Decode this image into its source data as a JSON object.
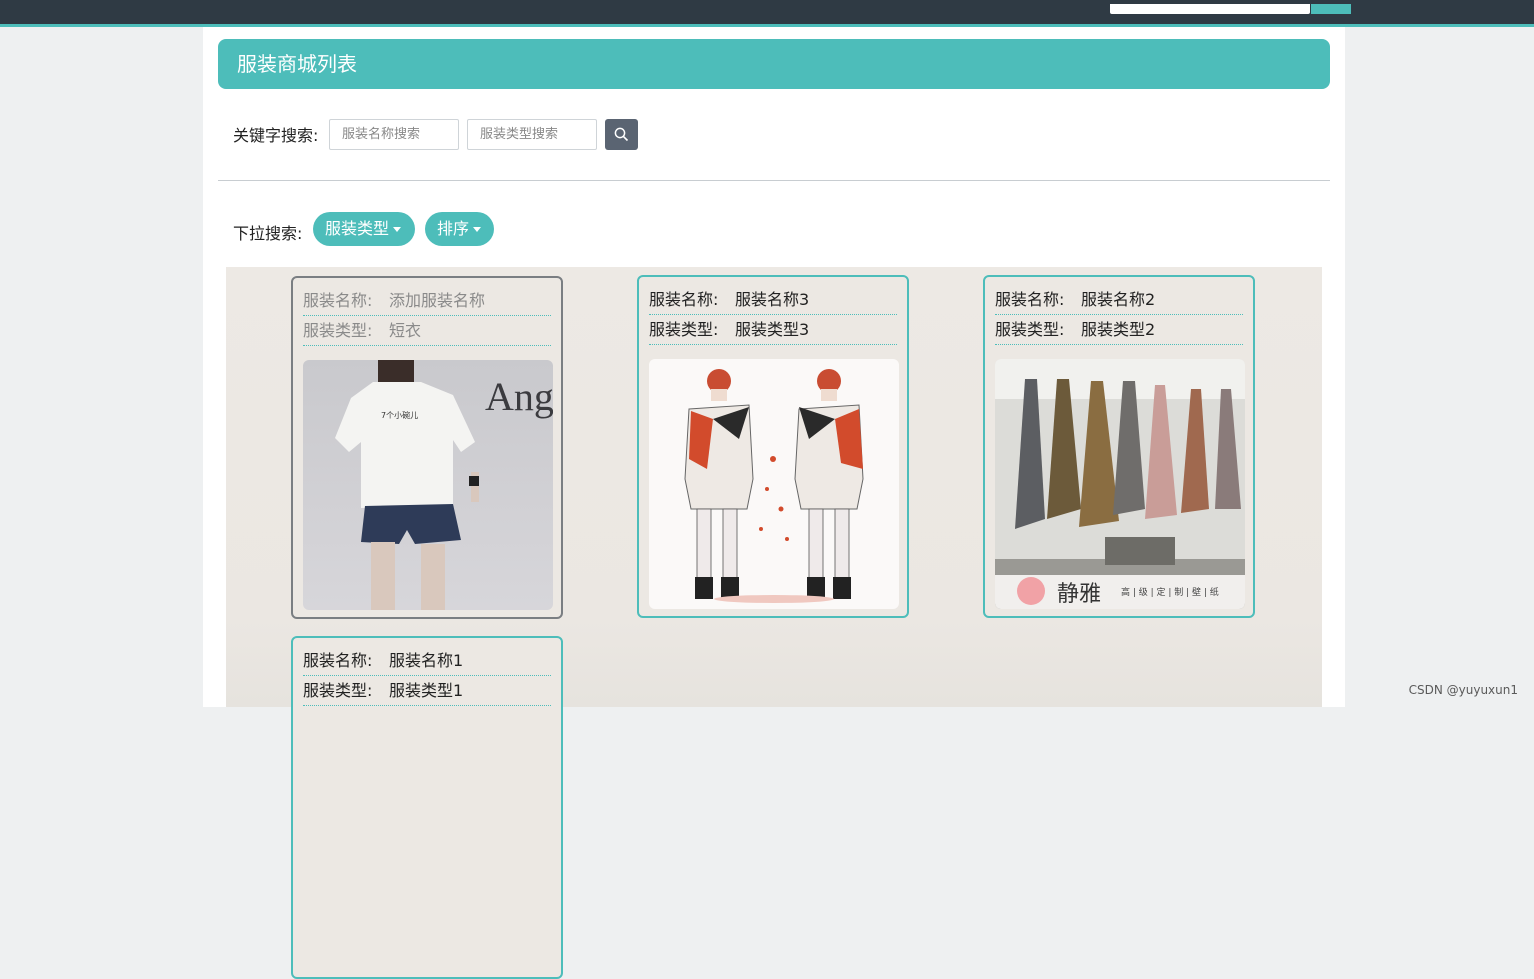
{
  "colors": {
    "accent": "#4dbdba",
    "topbar": "#2f3a44",
    "search_button": "#5a6472"
  },
  "page": {
    "title": "服装商城列表"
  },
  "keyword_search": {
    "label": "关键字搜索:",
    "name_placeholder": "服装名称搜索",
    "type_placeholder": "服装类型搜索",
    "button_icon": "search-icon"
  },
  "dropdown_search": {
    "label": "下拉搜索:",
    "type_button": "服装类型",
    "sort_button": "排序"
  },
  "cards": [
    {
      "name_label": "服装名称:",
      "name": "添加服装名称",
      "type_label": "服装类型:",
      "type": "短衣",
      "image": "white-tshirt-photo"
    },
    {
      "name_label": "服装名称:",
      "name": "服装名称3",
      "type_label": "服装类型:",
      "type": "服装类型3",
      "image": "fashion-illustration"
    },
    {
      "name_label": "服装名称:",
      "name": "服装名称2",
      "type_label": "服装类型:",
      "type": "服装类型2",
      "image": "wallpaper-models",
      "image_text": "静雅",
      "image_subtext": "高 | 级 | 定 | 制 | 壁 | 纸"
    },
    {
      "name_label": "服装名称:",
      "name": "服装名称1",
      "type_label": "服装类型:",
      "type": "服装类型1",
      "image": ""
    }
  ],
  "watermark": "CSDN @yuyuxun1"
}
